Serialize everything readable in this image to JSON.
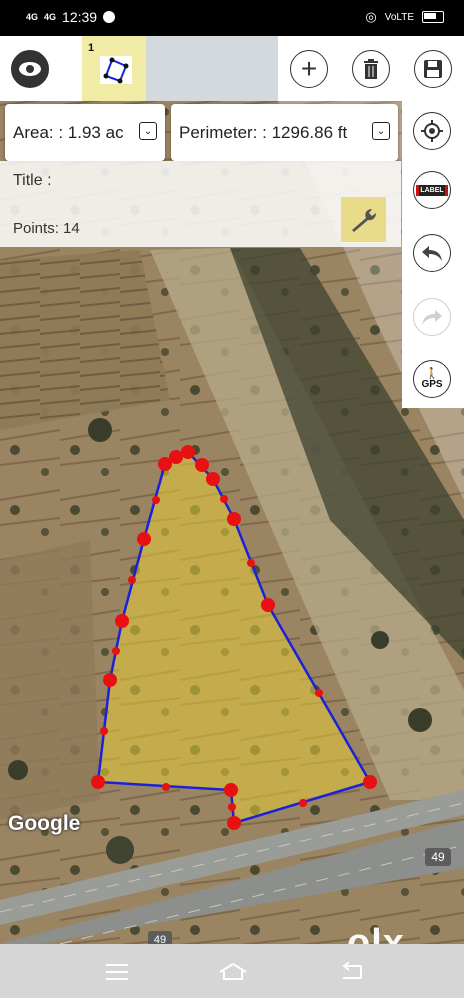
{
  "status_bar": {
    "time": "12:39",
    "network_1": "4G",
    "network_2": "4G",
    "volte": "VoLTE"
  },
  "toolbar": {
    "shape_tab_number": "1"
  },
  "measurements": {
    "area": "Area: : 1.93 ac",
    "perimeter": "Perimeter: : 1296.86 ft"
  },
  "info": {
    "title": "Title :",
    "points": "Points: 14"
  },
  "side_panel": {
    "label_text": "LABEL",
    "gps_text": "GPS"
  },
  "map": {
    "attribution": "Google",
    "road_shield_1": "49",
    "road_shield_2": "49",
    "polygon_fill": "#e6cc3a",
    "polygon_stroke": "#1a22d8",
    "vertex_color": "#e81010"
  },
  "watermark": "olx"
}
